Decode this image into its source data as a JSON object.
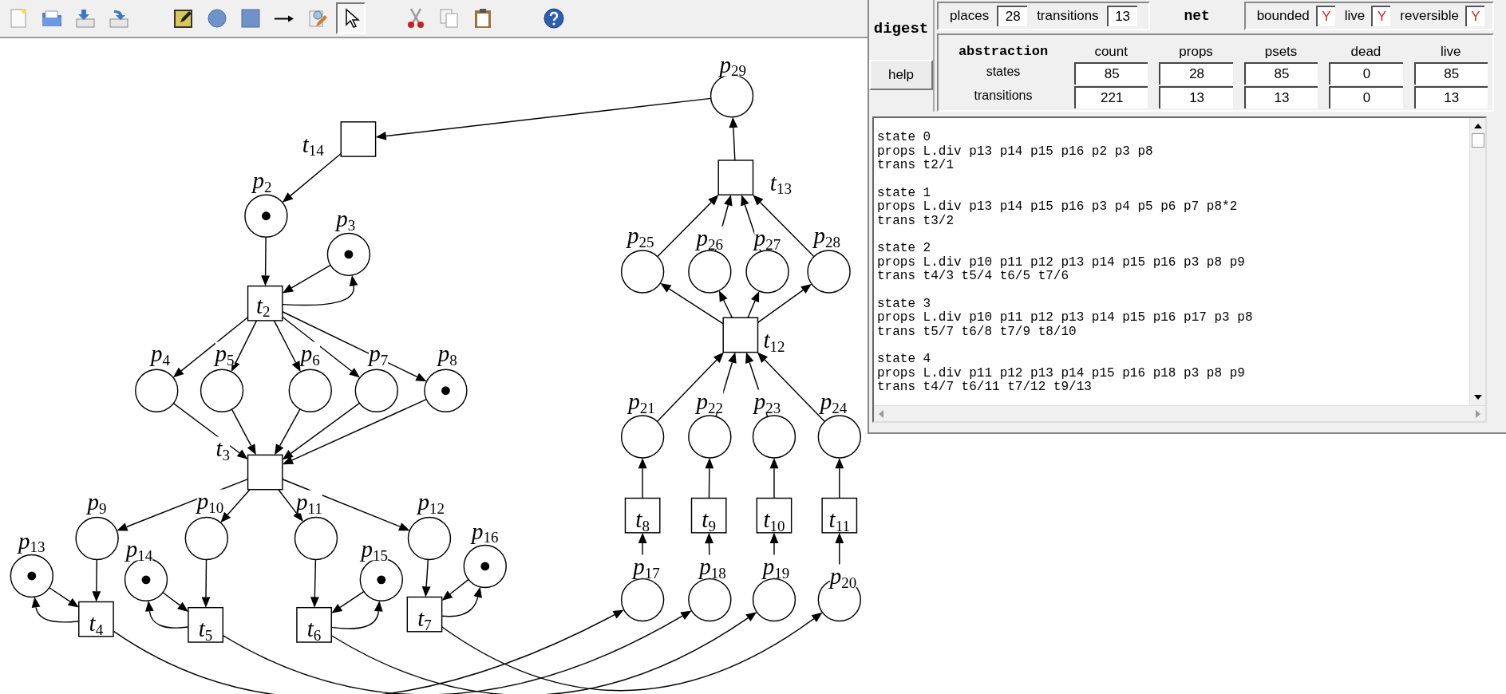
{
  "toolbar": {
    "groups": [
      [
        {
          "kind": "new",
          "selected": false
        },
        {
          "kind": "open",
          "selected": false
        },
        {
          "kind": "save",
          "selected": false
        },
        {
          "kind": "save-as",
          "selected": false
        }
      ],
      [
        {
          "kind": "annotate",
          "selected": false
        },
        {
          "kind": "place",
          "selected": false
        },
        {
          "kind": "transition",
          "selected": false
        },
        {
          "kind": "arc",
          "selected": false
        },
        {
          "kind": "inspect",
          "selected": false
        },
        {
          "kind": "select",
          "selected": true
        }
      ],
      [
        {
          "kind": "cut",
          "selected": false
        },
        {
          "kind": "copy",
          "selected": false
        },
        {
          "kind": "paste",
          "selected": false
        }
      ],
      [
        {
          "kind": "help",
          "selected": false
        }
      ]
    ]
  },
  "digest": {
    "title": "digest",
    "help_button": "help",
    "net": {
      "places_label": "places",
      "places": "28",
      "transitions_label": "transitions",
      "transitions": "13",
      "title": "net",
      "flags": [
        {
          "label": "bounded",
          "value": "Y"
        },
        {
          "label": "live",
          "value": "Y"
        },
        {
          "label": "reversible",
          "value": "Y"
        }
      ]
    },
    "abstraction": {
      "title": "abstraction",
      "columns": [
        "count",
        "props",
        "psets",
        "dead",
        "live"
      ],
      "rows": [
        {
          "label": "states",
          "values": [
            "85",
            "28",
            "85",
            "0",
            "85"
          ]
        },
        {
          "label": "transitions",
          "values": [
            "221",
            "13",
            "13",
            "0",
            "13"
          ]
        }
      ]
    }
  },
  "output": {
    "blocks": [
      {
        "lines": [
          "state 0",
          "props L.div p13 p14 p15 p16 p2 p3 p8",
          "trans t2/1"
        ]
      },
      {
        "lines": [
          "state 1",
          "props L.div p13 p14 p15 p16 p3 p4 p5 p6 p7 p8*2",
          "trans t3/2"
        ]
      },
      {
        "lines": [
          "state 2",
          "props L.div p10 p11 p12 p13 p14 p15 p16 p3 p8 p9",
          "trans t4/3 t5/4 t6/5 t7/6"
        ]
      },
      {
        "lines": [
          "state 3",
          "props L.div p10 p11 p12 p13 p14 p15 p16 p17 p3 p8",
          "trans t5/7 t6/8 t7/9 t8/10"
        ]
      },
      {
        "lines": [
          "state 4",
          "props L.div p11 p12 p13 p14 p15 p16 p18 p3 p8 p9",
          "trans t4/7 t6/11 t7/12 t9/13"
        ]
      }
    ]
  },
  "net": {
    "places": [
      {
        "label": "p$_{2}$",
        "marked": true
      },
      {
        "label": "p$_{3}$",
        "marked": true
      },
      {
        "label": "p$_{4}$",
        "marked": false
      },
      {
        "label": "p$_{5}$",
        "marked": false
      },
      {
        "label": "p$_{6}$",
        "marked": false
      },
      {
        "label": "p$_{7}$",
        "marked": false
      },
      {
        "label": "p$_{8}$",
        "marked": true
      },
      {
        "label": "p$_{9}$",
        "marked": false
      },
      {
        "label": "p$_{10}$",
        "marked": false
      },
      {
        "label": "p$_{11}$",
        "marked": false
      },
      {
        "label": "p$_{12}$",
        "marked": false
      },
      {
        "label": "p$_{13}$",
        "marked": true
      },
      {
        "label": "p$_{14}$",
        "marked": true
      },
      {
        "label": "p$_{15}$",
        "marked": true
      },
      {
        "label": "p$_{16}$",
        "marked": true
      },
      {
        "label": "p$_{17}$",
        "marked": false
      },
      {
        "label": "p$_{18}$",
        "marked": false
      },
      {
        "label": "p$_{19}$",
        "marked": false
      },
      {
        "label": "p$_{20}$",
        "marked": false
      },
      {
        "label": "p$_{21}$",
        "marked": false
      },
      {
        "label": "p$_{22}$",
        "marked": false
      },
      {
        "label": "p$_{23}$",
        "marked": false
      },
      {
        "label": "p$_{24}$",
        "marked": false
      },
      {
        "label": "p$_{25}$",
        "marked": false
      },
      {
        "label": "p$_{26}$",
        "marked": false
      },
      {
        "label": "p$_{27}$",
        "marked": false
      },
      {
        "label": "p$_{28}$",
        "marked": false
      },
      {
        "label": "p$_{29}$",
        "marked": false
      }
    ],
    "transitions": [
      {
        "label": "t$_{2}$"
      },
      {
        "label": "t$_{3}$"
      },
      {
        "label": "t$_{4}$"
      },
      {
        "label": "t$_{5}$"
      },
      {
        "label": "t$_{6}$"
      },
      {
        "label": "t$_{7}$"
      },
      {
        "label": "t$_{8}$"
      },
      {
        "label": "t$_{9}$"
      },
      {
        "label": "t$_{10}$"
      },
      {
        "label": "t$_{11}$"
      },
      {
        "label": "t$_{13}$"
      },
      {
        "label": "t$_{12}$"
      },
      {
        "label": "t$_{14}$"
      }
    ]
  }
}
